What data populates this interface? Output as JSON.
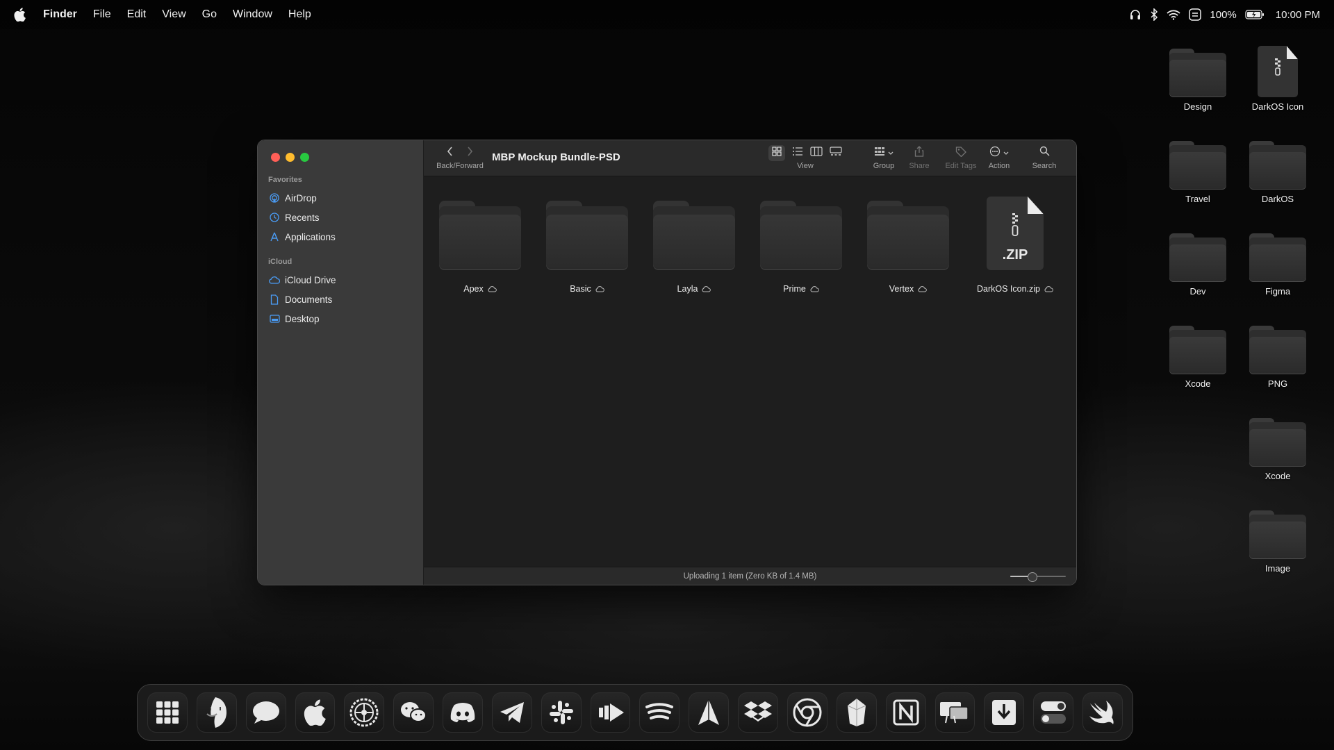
{
  "menubar": {
    "app_name": "Finder",
    "menus": [
      "File",
      "Edit",
      "View",
      "Go",
      "Window",
      "Help"
    ],
    "battery": "100%",
    "time": "10:00 PM"
  },
  "desktop": {
    "items": [
      {
        "label": "Design",
        "kind": "folder"
      },
      {
        "label": "DarkOS Icon",
        "kind": "zip"
      },
      {
        "label": "Travel",
        "kind": "folder"
      },
      {
        "label": "DarkOS",
        "kind": "folder"
      },
      {
        "label": "Dev",
        "kind": "folder"
      },
      {
        "label": "Figma",
        "kind": "folder"
      },
      {
        "label": "Xcode",
        "kind": "folder"
      },
      {
        "label": "PNG",
        "kind": "folder"
      },
      {
        "label": "Xcode",
        "kind": "folder"
      },
      {
        "label": "Image",
        "kind": "folder"
      }
    ]
  },
  "finder": {
    "title": "MBP Mockup Bundle-PSD",
    "sidebar": {
      "favorites_heading": "Favorites",
      "favorites": [
        {
          "label": "AirDrop",
          "icon": "airdrop-icon"
        },
        {
          "label": "Recents",
          "icon": "clock-icon"
        },
        {
          "label": "Applications",
          "icon": "applications-icon"
        }
      ],
      "icloud_heading": "iCloud",
      "icloud": [
        {
          "label": "iCloud Drive",
          "icon": "cloud-icon"
        },
        {
          "label": "Documents",
          "icon": "document-icon"
        },
        {
          "label": "Desktop",
          "icon": "desktop-icon"
        }
      ]
    },
    "toolbar": {
      "back_forward_label": "Back/Forward",
      "view_label": "View",
      "group_label": "Group",
      "share_label": "Share",
      "edit_tags_label": "Edit Tags",
      "action_label": "Action",
      "search_label": "Search"
    },
    "files": [
      {
        "name": "Apex",
        "kind": "folder"
      },
      {
        "name": "Basic",
        "kind": "folder"
      },
      {
        "name": "Layla",
        "kind": "folder"
      },
      {
        "name": "Prime",
        "kind": "folder"
      },
      {
        "name": "Vertex",
        "kind": "folder"
      },
      {
        "name": "DarkOS Icon.zip",
        "kind": "zip",
        "ext": ".ZIP"
      }
    ],
    "status": "Uploading 1 item (Zero KB of 1.4 MB)",
    "icon_size_slider": 0.4
  },
  "dock": {
    "apps": [
      "launchpad-icon",
      "finder-icon",
      "messages-icon",
      "apple-icon",
      "system-settings-icon",
      "wechat-icon",
      "discord-icon",
      "telegram-icon",
      "slack-icon",
      "infuse-icon",
      "spotify-icon",
      "navigation-icon",
      "dropbox-icon",
      "chrome-icon",
      "crystal-icon",
      "notion-icon",
      "sidecar-icon",
      "downloads-icon",
      "toggle-icon",
      "swift-icon"
    ]
  },
  "colors": {
    "close": "#ff5f57",
    "minimize": "#febc2e",
    "zoom": "#28c840",
    "sidebar_accent": "#4a9cf5"
  }
}
